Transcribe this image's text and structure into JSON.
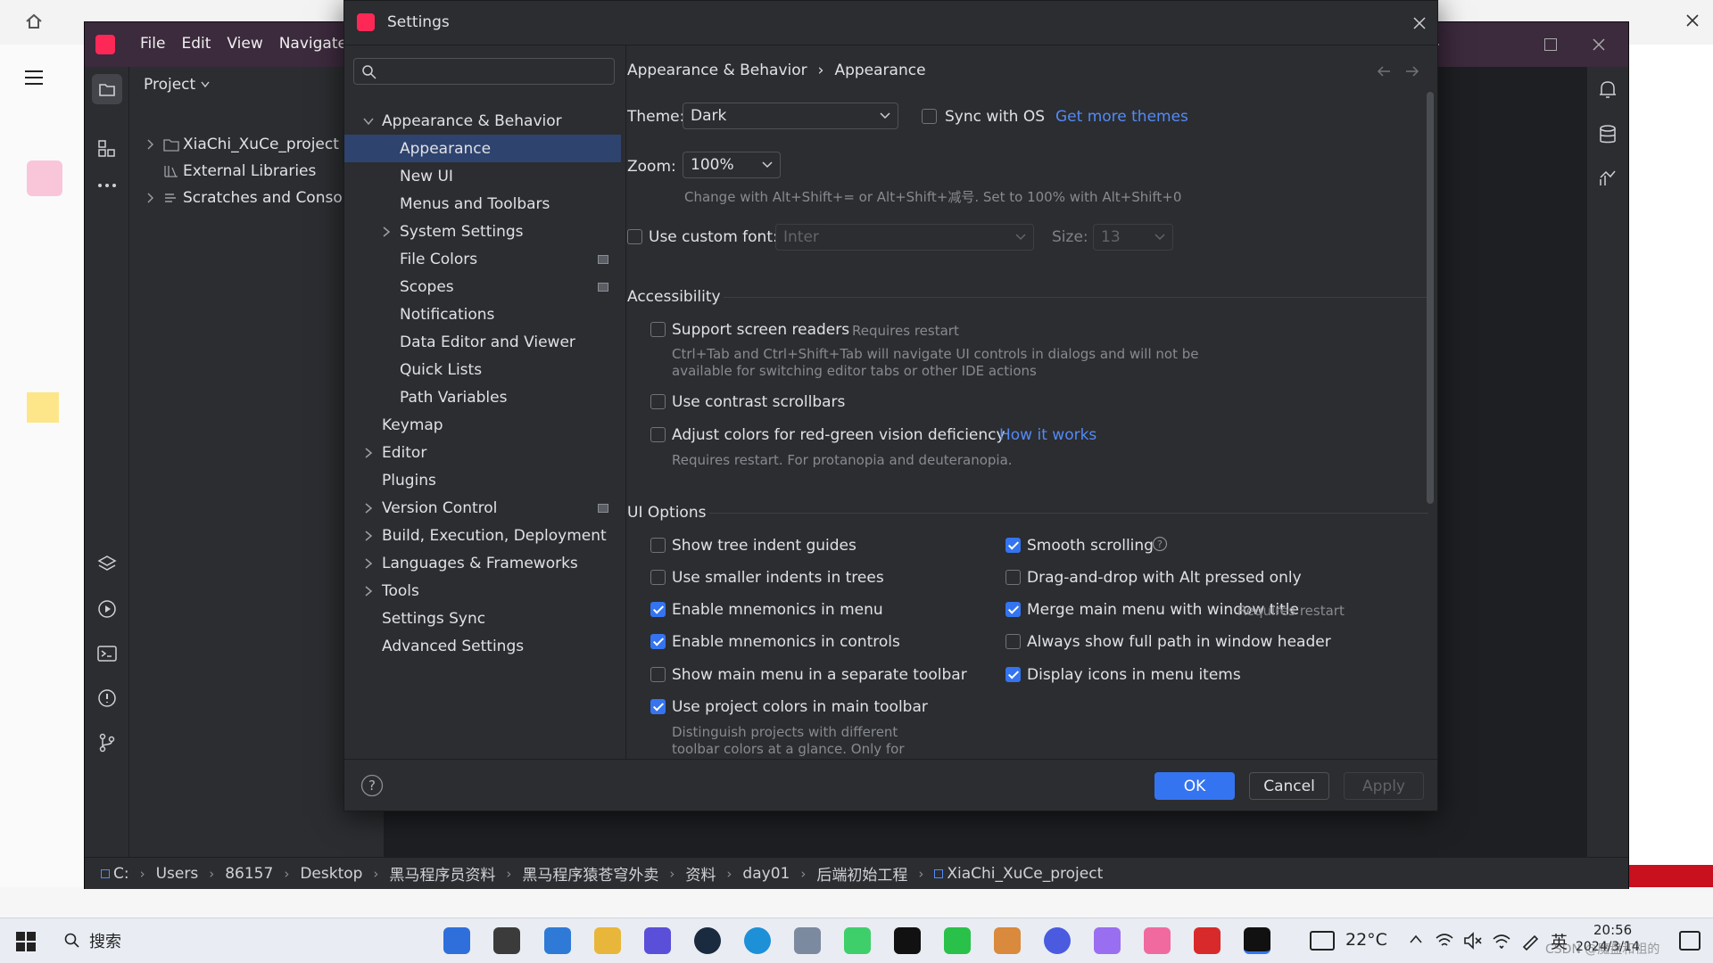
{
  "ide": {
    "menu": [
      "File",
      "Edit",
      "View",
      "Navigate"
    ],
    "project_label": "Project",
    "tree": [
      {
        "label": "XiaChi_XuCe_project"
      },
      {
        "label": "External Libraries"
      },
      {
        "label": "Scratches and Console"
      }
    ],
    "breadcrumb": [
      "C:",
      "Users",
      "86157",
      "Desktop",
      "黑马程序员资料",
      "黑马程序猿苍穹外卖",
      "资料",
      "day01",
      "后端初始工程",
      "XiaChi_XuCe_project"
    ]
  },
  "dialog": {
    "title": "Settings",
    "search_placeholder": "",
    "breadcrumb": {
      "parent": "Appearance & Behavior",
      "sep": "›",
      "current": "Appearance"
    },
    "nav": [
      {
        "label": "Appearance & Behavior",
        "level": 0,
        "expanded": true
      },
      {
        "label": "Appearance",
        "level": 1,
        "selected": true
      },
      {
        "label": "New UI",
        "level": 1
      },
      {
        "label": "Menus and Toolbars",
        "level": 1
      },
      {
        "label": "System Settings",
        "level": 1,
        "collapsed": true
      },
      {
        "label": "File Colors",
        "level": 1,
        "badge": true
      },
      {
        "label": "Scopes",
        "level": 1,
        "badge": true
      },
      {
        "label": "Notifications",
        "level": 1
      },
      {
        "label": "Data Editor and Viewer",
        "level": 1
      },
      {
        "label": "Quick Lists",
        "level": 1
      },
      {
        "label": "Path Variables",
        "level": 1
      },
      {
        "label": "Keymap",
        "level": 0
      },
      {
        "label": "Editor",
        "level": 0,
        "collapsed": true
      },
      {
        "label": "Plugins",
        "level": 0
      },
      {
        "label": "Version Control",
        "level": 0,
        "collapsed": true,
        "badge": true
      },
      {
        "label": "Build, Execution, Deployment",
        "level": 0,
        "collapsed": true
      },
      {
        "label": "Languages & Frameworks",
        "level": 0,
        "collapsed": true
      },
      {
        "label": "Tools",
        "level": 0,
        "collapsed": true
      },
      {
        "label": "Settings Sync",
        "level": 0
      },
      {
        "label": "Advanced Settings",
        "level": 0
      }
    ],
    "theme": {
      "label": "Theme:",
      "value": "Dark",
      "sync_label": "Sync with OS",
      "more_link": "Get more themes"
    },
    "zoom": {
      "label": "Zoom:",
      "value": "100%",
      "hint": "Change with Alt+Shift+= or Alt+Shift+减号. Set to 100% with Alt+Shift+0"
    },
    "font": {
      "label": "Use custom font:",
      "value": "Inter",
      "size_label": "Size:",
      "size_value": "13"
    },
    "accessibility": {
      "title": "Accessibility",
      "screen_readers": "Support screen readers",
      "screen_readers_note": "Requires restart",
      "screen_readers_hint1": "Ctrl+Tab and Ctrl+Shift+Tab will navigate UI controls in dialogs and will not be",
      "screen_readers_hint2": "available for switching editor tabs or other IDE actions",
      "contrast": "Use contrast scrollbars",
      "color_def": "Adjust colors for red-green vision deficiency",
      "how_link": "How it works",
      "color_hint": "Requires restart. For protanopia and deuteranopia."
    },
    "ui_options": {
      "title": "UI Options",
      "left": [
        {
          "label": "Show tree indent guides",
          "checked": false
        },
        {
          "label": "Use smaller indents in trees",
          "checked": false
        },
        {
          "label": "Enable mnemonics in menu",
          "checked": true
        },
        {
          "label": "Enable mnemonics in controls",
          "checked": true
        },
        {
          "label": "Show main menu in a separate toolbar",
          "checked": false
        },
        {
          "label": "Use project colors in main toolbar",
          "checked": true
        }
      ],
      "left_hint1": "Distinguish projects with different",
      "left_hint2": "toolbar colors at a glance. Only for",
      "right": [
        {
          "label": "Smooth scrolling",
          "checked": true
        },
        {
          "label": "Drag-and-drop with Alt pressed only",
          "checked": false
        },
        {
          "label": "Merge main menu with window title",
          "checked": true,
          "note": "Requires restart"
        },
        {
          "label": "Always show full path in window header",
          "checked": false
        },
        {
          "label": "Display icons in menu items",
          "checked": true
        }
      ]
    },
    "buttons": {
      "ok": "OK",
      "cancel": "Cancel",
      "apply": "Apply"
    }
  },
  "taskbar": {
    "search_label": "搜索",
    "weather": "22°C",
    "ime": "英",
    "time": "20:56",
    "date": "2024/3/14",
    "watermark": "CSDN @魔盘和祖的"
  },
  "colors": {
    "accent": "#3574f0",
    "link": "#548af7",
    "selection": "#2e436e",
    "titlebar": "#3c2a3d"
  }
}
